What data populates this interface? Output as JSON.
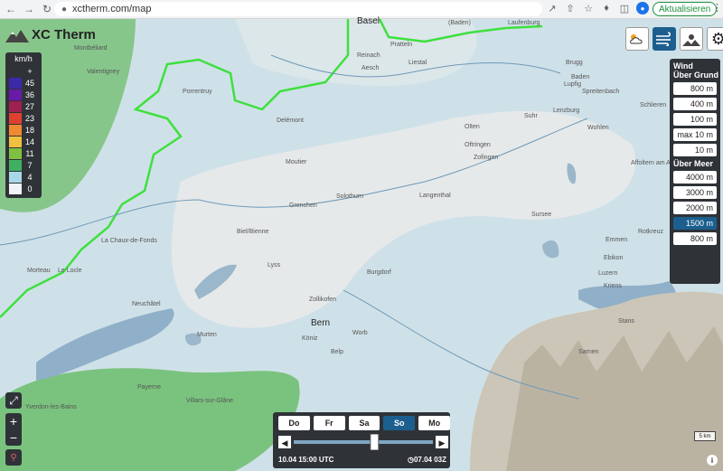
{
  "browser": {
    "url": "xctherm.com/map",
    "update_label": "Aktualisieren"
  },
  "logo": {
    "text": "XC Therm"
  },
  "legend": {
    "unit": "km/h",
    "top_label": "+",
    "entries": [
      {
        "value": "45",
        "color": "#3a2aa8"
      },
      {
        "value": "36",
        "color": "#6a1aa8"
      },
      {
        "value": "27",
        "color": "#a02050"
      },
      {
        "value": "23",
        "color": "#e04030"
      },
      {
        "value": "18",
        "color": "#f08a30"
      },
      {
        "value": "14",
        "color": "#f0c040"
      },
      {
        "value": "11",
        "color": "#80c040"
      },
      {
        "value": "7",
        "color": "#40b060"
      },
      {
        "value": "4",
        "color": "#a8d8e8"
      },
      {
        "value": "0",
        "color": "#f0f4f6"
      }
    ]
  },
  "top_icons": [
    {
      "name": "cloud-sun-icon",
      "active": false
    },
    {
      "name": "wind-icon",
      "active": true
    },
    {
      "name": "sun-terrain-icon",
      "active": false
    },
    {
      "name": "gear-icon",
      "active": false
    }
  ],
  "altitude_panel": {
    "title": "Wind",
    "above_ground_label": "Über Grund",
    "above_ground": [
      "800 m",
      "400 m",
      "100 m",
      "max 10 m",
      "10 m"
    ],
    "above_sea_label": "Über Meer",
    "above_sea": [
      "4000 m",
      "3000 m",
      "2000 m",
      "1500 m",
      "800 m"
    ],
    "selected": "1500 m"
  },
  "time_panel": {
    "days": [
      "Do",
      "Fr",
      "Sa",
      "So",
      "Mo"
    ],
    "selected_day": "So",
    "current_time": "10.04 15:00 UTC",
    "model_run": "07.04 03Z",
    "slider_position": 0.58
  },
  "scale_label": "5 km",
  "info_label": "i",
  "map_controls": {
    "zoom_in": "+",
    "zoom_out": "−"
  },
  "places": [
    {
      "name": "Basel",
      "cls": "big"
    },
    {
      "name": "(Baden)",
      "cls": ""
    },
    {
      "name": "Laufenburg",
      "cls": ""
    },
    {
      "name": "Pratteln",
      "cls": ""
    },
    {
      "name": "Montbéliard",
      "cls": ""
    },
    {
      "name": "Reinach",
      "cls": ""
    },
    {
      "name": "Liestal",
      "cls": ""
    },
    {
      "name": "Aesch",
      "cls": ""
    },
    {
      "name": "Brugg",
      "cls": ""
    },
    {
      "name": "Baden",
      "cls": ""
    },
    {
      "name": "Valentigney",
      "cls": ""
    },
    {
      "name": "Lupfig",
      "cls": ""
    },
    {
      "name": "Porrentruy",
      "cls": ""
    },
    {
      "name": "Spreitenbach",
      "cls": ""
    },
    {
      "name": "Schlieren",
      "cls": ""
    },
    {
      "name": "Delémont",
      "cls": ""
    },
    {
      "name": "Olten",
      "cls": ""
    },
    {
      "name": "Suhr",
      "cls": ""
    },
    {
      "name": "Lenzburg",
      "cls": ""
    },
    {
      "name": "Wohlen",
      "cls": ""
    },
    {
      "name": "Oftringen",
      "cls": ""
    },
    {
      "name": "Moutier",
      "cls": ""
    },
    {
      "name": "Zofingen",
      "cls": ""
    },
    {
      "name": "Affoltern am Albis",
      "cls": ""
    },
    {
      "name": "Solothurn",
      "cls": ""
    },
    {
      "name": "Langenthal",
      "cls": ""
    },
    {
      "name": "Grenchen",
      "cls": ""
    },
    {
      "name": "Sursee",
      "cls": ""
    },
    {
      "name": "Cham",
      "cls": ""
    },
    {
      "name": "La Chaux-de-Fonds",
      "cls": ""
    },
    {
      "name": "Biel/Bienne",
      "cls": ""
    },
    {
      "name": "Rotkreuz",
      "cls": ""
    },
    {
      "name": "Emmen",
      "cls": ""
    },
    {
      "name": "Ebikon",
      "cls": ""
    },
    {
      "name": "Morteau",
      "cls": ""
    },
    {
      "name": "Lyss",
      "cls": ""
    },
    {
      "name": "Le Locle",
      "cls": ""
    },
    {
      "name": "Burgdorf",
      "cls": ""
    },
    {
      "name": "Luzern",
      "cls": ""
    },
    {
      "name": "Kriens",
      "cls": ""
    },
    {
      "name": "Neuchâtel",
      "cls": ""
    },
    {
      "name": "Zollikofen",
      "cls": ""
    },
    {
      "name": "Bern",
      "cls": "big"
    },
    {
      "name": "Stans",
      "cls": ""
    },
    {
      "name": "Murten",
      "cls": ""
    },
    {
      "name": "Worb",
      "cls": ""
    },
    {
      "name": "Köniz",
      "cls": ""
    },
    {
      "name": "Sarnen",
      "cls": ""
    },
    {
      "name": "Belp",
      "cls": ""
    },
    {
      "name": "Payerne",
      "cls": ""
    },
    {
      "name": "Villars-sur-Glâne",
      "cls": ""
    },
    {
      "name": "Yverdon-les-Bains",
      "cls": ""
    }
  ]
}
